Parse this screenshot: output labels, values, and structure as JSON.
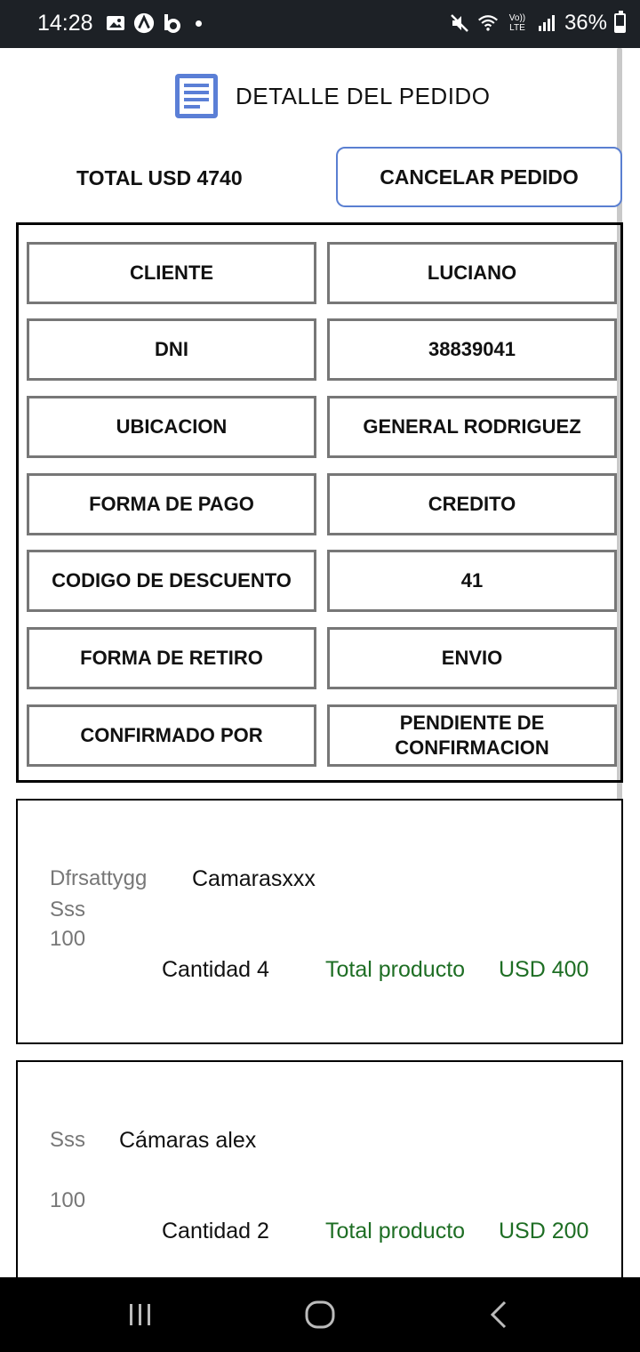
{
  "status_bar": {
    "time": "14:28",
    "battery": "36%",
    "battery_level": 0.36,
    "icons_left": [
      "gallery-icon",
      "a-app-icon",
      "b-app-icon",
      "dot-icon"
    ],
    "icons_right": [
      "mute-icon",
      "wifi-icon",
      "volte-icon",
      "signal-icon",
      "battery-icon"
    ],
    "volte_label": "Vo)) LTE"
  },
  "header": {
    "title": "DETALLE DEL PEDIDO",
    "icon": "document-icon",
    "icon_color": "#5b7fd6"
  },
  "summary": {
    "total_label": "TOTAL USD 4740",
    "cancel_label": "CANCELAR PEDIDO"
  },
  "details": [
    {
      "label": "CLIENTE",
      "value": "LUCIANO"
    },
    {
      "label": "DNI",
      "value": "38839041"
    },
    {
      "label": "UBICACION",
      "value": "GENERAL RODRIGUEZ"
    },
    {
      "label": "FORMA DE PAGO",
      "value": "CREDITO"
    },
    {
      "label": "CODIGO DE DESCUENTO",
      "value": "41"
    },
    {
      "label": "FORMA DE RETIRO",
      "value": "ENVIO"
    },
    {
      "label": "CONFIRMADO POR",
      "value": "PENDIENTE DE CONFIRMACION"
    }
  ],
  "products": [
    {
      "code": "Dfrsattygg",
      "name": "Camarasxxx",
      "line2": "Sss",
      "line3": "100",
      "quantity": "Cantidad 4",
      "total_label": "Total producto",
      "total_value": "USD 400"
    },
    {
      "code": "Sss",
      "name": "Cámaras alex",
      "line3": "100",
      "quantity": "Cantidad 2",
      "total_label": "Total producto",
      "total_value": "USD 200"
    }
  ],
  "colors": {
    "accent": "#5a7fd1",
    "green": "#1e6e24",
    "gray_text": "#777777",
    "status_bar": "#1d2126"
  },
  "nav": {
    "icons": [
      "recent-apps-icon",
      "home-icon",
      "back-icon"
    ]
  }
}
